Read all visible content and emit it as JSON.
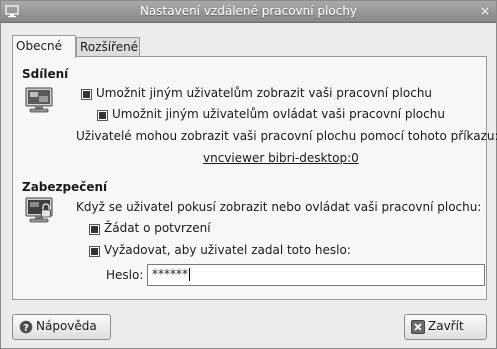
{
  "window": {
    "title": "Nastavení vzdálené pracovní plochy",
    "close_label": "×"
  },
  "tabs": [
    {
      "label": "Obecné",
      "active": true
    },
    {
      "label": "Rozšířené",
      "active": false
    }
  ],
  "sharing": {
    "heading": "Sdílení",
    "allow_view": {
      "label": "Umožnit jiným uživatelům zobrazit vaši pracovní plochu",
      "checked": true
    },
    "allow_control": {
      "label": "Umožnit jiným uživatelům ovládat vaši pracovní plochu",
      "checked": true
    },
    "info": "Uživatelé mohou zobrazit vaši pracovní plochu pomocí tohoto příkazu:",
    "command": "vncviewer bibri-desktop:0"
  },
  "security": {
    "heading": "Zabezpečení",
    "intro": "Když se uživatel pokusí zobrazit nebo ovládat vaši pracovní plochu:",
    "ask_confirm": {
      "label": "Žádat o potvrzení",
      "checked": true
    },
    "require_password": {
      "label": "Vyžadovat, aby uživatel zadal toto heslo:",
      "checked": true
    },
    "password_label": "Heslo:",
    "password_value": "******"
  },
  "buttons": {
    "help": "Nápověda",
    "close": "Zavřít"
  },
  "icons": [
    "window-menu-icon",
    "desktop-sharing-icon",
    "lock-screen-icon",
    "help-icon",
    "close-icon"
  ]
}
